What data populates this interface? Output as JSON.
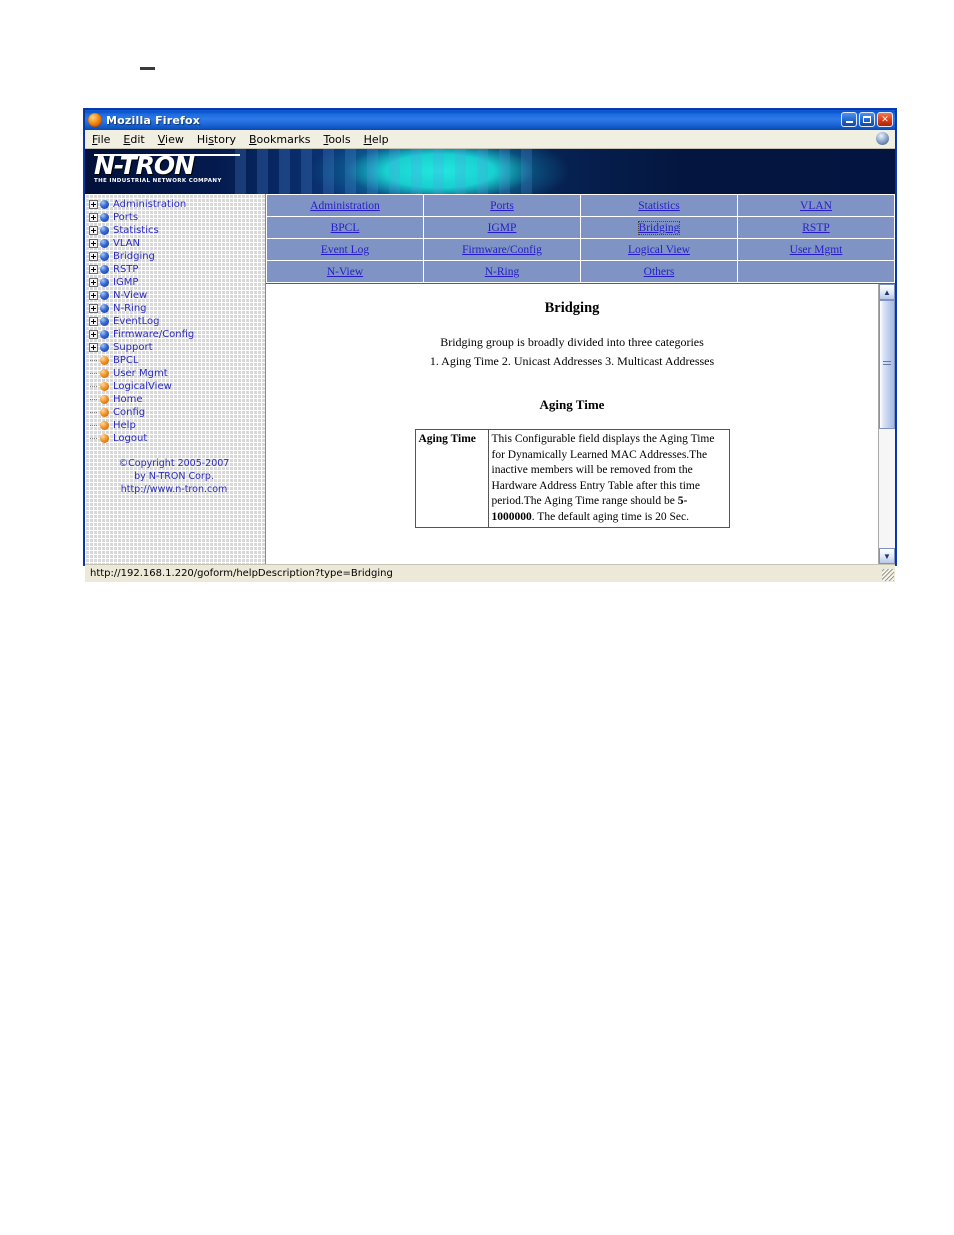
{
  "window": {
    "title": "Mozilla Firefox",
    "icon": "firefox-icon",
    "buttons": {
      "minimize": "minimize",
      "maximize": "maximize",
      "close": "close"
    }
  },
  "menubar": {
    "items": [
      {
        "label": "File",
        "accesskey": "F"
      },
      {
        "label": "Edit",
        "accesskey": "E"
      },
      {
        "label": "View",
        "accesskey": "V"
      },
      {
        "label": "History",
        "accesskey": "s"
      },
      {
        "label": "Bookmarks",
        "accesskey": "B"
      },
      {
        "label": "Tools",
        "accesskey": "T"
      },
      {
        "label": "Help",
        "accesskey": "H"
      }
    ]
  },
  "banner": {
    "logo_main": "N-TRON",
    "logo_sub": "THE INDUSTRIAL NETWORK COMPANY"
  },
  "sidebar": {
    "tree": [
      {
        "label": "Administration",
        "type": "branch",
        "bullet": "blue"
      },
      {
        "label": "Ports",
        "type": "branch",
        "bullet": "blue"
      },
      {
        "label": "Statistics",
        "type": "branch",
        "bullet": "blue"
      },
      {
        "label": "VLAN",
        "type": "branch",
        "bullet": "blue"
      },
      {
        "label": "Bridging",
        "type": "branch",
        "bullet": "blue"
      },
      {
        "label": "RSTP",
        "type": "branch",
        "bullet": "blue"
      },
      {
        "label": "IGMP",
        "type": "branch",
        "bullet": "blue"
      },
      {
        "label": "N-View",
        "type": "branch",
        "bullet": "blue"
      },
      {
        "label": "N-Ring",
        "type": "branch",
        "bullet": "blue"
      },
      {
        "label": "EventLog",
        "type": "branch",
        "bullet": "blue"
      },
      {
        "label": "Firmware/Config",
        "type": "branch",
        "bullet": "blue"
      },
      {
        "label": "Support",
        "type": "branch",
        "bullet": "blue"
      },
      {
        "label": "BPCL",
        "type": "leaf",
        "bullet": "orange"
      },
      {
        "label": "User Mgmt",
        "type": "leaf",
        "bullet": "orange"
      },
      {
        "label": "LogicalView",
        "type": "leaf",
        "bullet": "orange"
      },
      {
        "label": "Home",
        "type": "leaf",
        "bullet": "orange"
      },
      {
        "label": "Config",
        "type": "leaf",
        "bullet": "orange"
      },
      {
        "label": "Help",
        "type": "leaf",
        "bullet": "orange"
      },
      {
        "label": "Logout",
        "type": "leaf",
        "bullet": "orange"
      }
    ],
    "copyright_line1": "©Copyright 2005-2007",
    "copyright_line2": "by N-TRON Corp.",
    "copyright_line3": "http://www.n-tron.com"
  },
  "nav_table": {
    "rows": [
      [
        {
          "label": "Administration",
          "current": false
        },
        {
          "label": "Ports",
          "current": false
        },
        {
          "label": "Statistics",
          "current": false
        },
        {
          "label": "VLAN",
          "current": false
        }
      ],
      [
        {
          "label": "BPCL",
          "current": false
        },
        {
          "label": "IGMP",
          "current": false
        },
        {
          "label": "Bridging",
          "current": true
        },
        {
          "label": "RSTP",
          "current": false
        }
      ],
      [
        {
          "label": "Event Log",
          "current": false
        },
        {
          "label": "Firmware/Config",
          "current": false
        },
        {
          "label": "Logical View",
          "current": false
        },
        {
          "label": "User Mgmt",
          "current": false
        }
      ],
      [
        {
          "label": "N-View",
          "current": false
        },
        {
          "label": "N-Ring",
          "current": false
        },
        {
          "label": "Others",
          "current": false
        },
        {
          "label": "",
          "current": false
        }
      ]
    ]
  },
  "content": {
    "heading": "Bridging",
    "intro_line1": "Bridging group is broadly divided into three categories",
    "intro_line2": "1. Aging Time    2. Unicast Addresses   3. Multicast Addresses",
    "subheading": "Aging Time",
    "table": {
      "key": "Aging Time",
      "value_part1": "This Configurable field displays the Aging Time for Dynamically Learned MAC Addresses.The inactive members will be removed from the Hardware Address Entry Table after this time period.The Aging Time range should be ",
      "value_bold": "5-1000000",
      "value_part2": ". The default aging time is 20 Sec."
    }
  },
  "scrollbar": {
    "up_arrow": "scroll-up-icon",
    "down_arrow": "scroll-down-icon"
  },
  "statusbar": {
    "url": "http://192.168.1.220/goform/helpDescription?type=Bridging"
  },
  "colors": {
    "titlebar_blue": "#0a52c8",
    "nav_table_bg": "#7f94c4",
    "link_blue": "#261cc9",
    "sidebar_bg": "#d8d8d8",
    "tree_text": "#2b2bbb",
    "banner_dark": "#041a4e",
    "banner_cyan": "#19cfd0"
  }
}
